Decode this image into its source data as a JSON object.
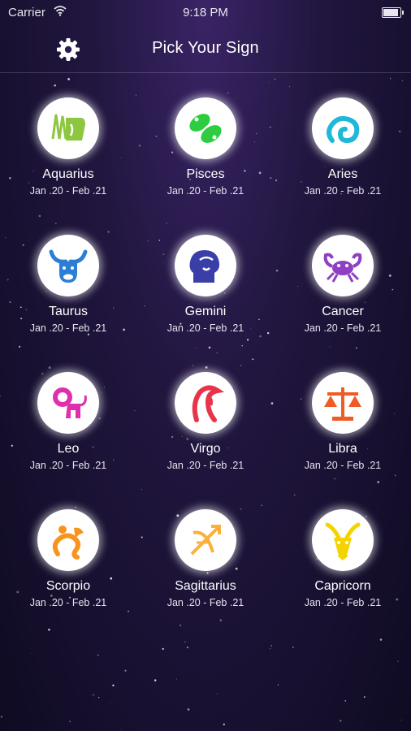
{
  "status_bar": {
    "carrier": "Carrier",
    "time": "9:18 PM",
    "battery_level": 0.95
  },
  "header": {
    "title": "Pick Your Sign",
    "settings_icon": "gear-icon"
  },
  "signs": [
    {
      "name": "Aquarius",
      "dates": "Jan .20 - Feb .21",
      "icon": "aquarius-icon",
      "color": "#8dc63f"
    },
    {
      "name": "Pisces",
      "dates": "Jan .20 - Feb .21",
      "icon": "pisces-icon",
      "color": "#2ecc40"
    },
    {
      "name": "Aries",
      "dates": "Jan .20 - Feb .21",
      "icon": "aries-icon",
      "color": "#1fb8d8"
    },
    {
      "name": "Taurus",
      "dates": "Jan .20 - Feb .21",
      "icon": "taurus-icon",
      "color": "#2a7fd4"
    },
    {
      "name": "Gemini",
      "dates": "Jan .20 - Feb .21",
      "icon": "gemini-icon",
      "color": "#3a3fa8"
    },
    {
      "name": "Cancer",
      "dates": "Jan .20 - Feb .21",
      "icon": "cancer-icon",
      "color": "#8e3fc4"
    },
    {
      "name": "Leo",
      "dates": "Jan .20 - Feb .21",
      "icon": "leo-icon",
      "color": "#e02fae"
    },
    {
      "name": "Virgo",
      "dates": "Jan .20 - Feb .21",
      "icon": "virgo-icon",
      "color": "#e8334a"
    },
    {
      "name": "Libra",
      "dates": "Jan .20 - Feb .21",
      "icon": "libra-icon",
      "color": "#f05a24"
    },
    {
      "name": "Scorpio",
      "dates": "Jan .20 - Feb .21",
      "icon": "scorpio-icon",
      "color": "#f7941d"
    },
    {
      "name": "Sagittarius",
      "dates": "Jan .20 - Feb .21",
      "icon": "sagittarius-icon",
      "color": "#fbb03b"
    },
    {
      "name": "Capricorn",
      "dates": "Jan .20 - Feb .21",
      "icon": "capricorn-icon",
      "color": "#f5d300"
    }
  ]
}
